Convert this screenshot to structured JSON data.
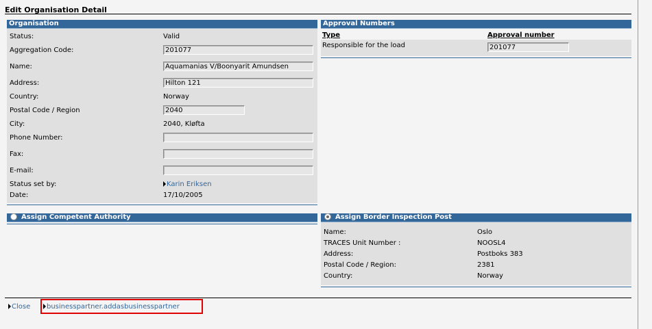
{
  "page": {
    "title": "Edit Organisation Detail"
  },
  "organisation": {
    "header": "Organisation",
    "status_label": "Status:",
    "status_value": "Valid",
    "aggregation_label": "Aggregation Code:",
    "aggregation_value": "201077",
    "name_label": "Name:",
    "name_value": "Aquamanias V/Boonyarit Amundsen",
    "address_label": "Address:",
    "address_value": "Hilton 121",
    "country_label": "Country:",
    "country_value": "Norway",
    "postal_label": "Postal Code / Region",
    "postal_value": "2040",
    "city_label": "City:",
    "city_value": "2040, Kløfta",
    "phone_label": "Phone Number:",
    "phone_value": "",
    "fax_label": "Fax:",
    "fax_value": "",
    "email_label": "E-mail:",
    "email_value": "",
    "status_set_label": "Status set by:",
    "status_set_value": "Karin Eriksen",
    "date_label": "Date:",
    "date_value": "17/10/2005"
  },
  "approval": {
    "header": "Approval Numbers",
    "col_type": "Type",
    "col_number": "Approval number",
    "rows": [
      {
        "type": "Responsible for the load",
        "number": "201077"
      }
    ]
  },
  "competent_authority": {
    "header": "Assign Competent Authority",
    "selected": false
  },
  "border_post": {
    "header": "Assign Border Inspection Post",
    "selected": true,
    "name_label": "Name:",
    "name_value": "Oslo",
    "unit_label": "TRACES Unit Number :",
    "unit_value": "NOOSL4",
    "address_label": "Address:",
    "address_value": "Postboks 383",
    "postal_label": "Postal Code / Region:",
    "postal_value": "2381",
    "country_label": "Country:",
    "country_value": "Norway"
  },
  "footer": {
    "close_label": "Close",
    "add_partner_label": "businesspartner.addasbusinesspartner"
  },
  "colors": {
    "header_blue": "#336699",
    "panel_gray": "#e0e0e0",
    "highlight_red": "#e00000"
  }
}
